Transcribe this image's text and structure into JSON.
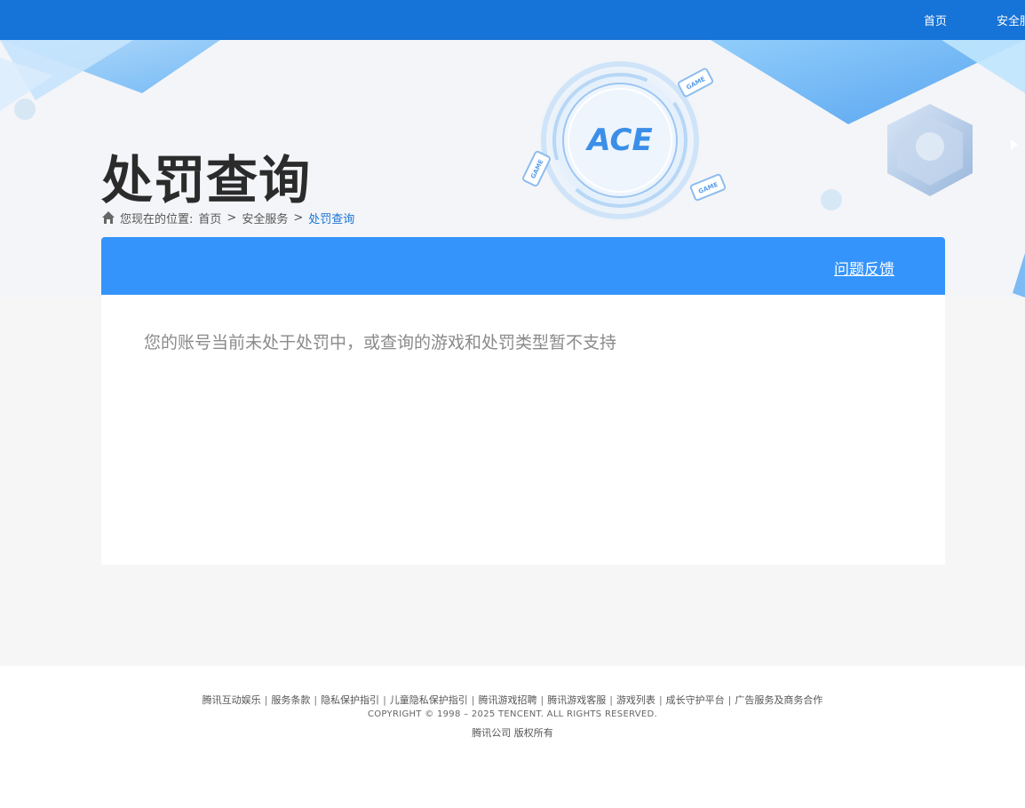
{
  "topnav": {
    "items": [
      {
        "label": "首页"
      },
      {
        "label": "安全服务"
      }
    ]
  },
  "banner": {
    "title": "处罚查询",
    "logo_text": "ACE",
    "game_tag": "GAME"
  },
  "breadcrumb": {
    "prefix": "您现在的位置:",
    "items": [
      {
        "label": "首页"
      },
      {
        "label": "安全服务"
      },
      {
        "label": "处罚查询"
      }
    ],
    "separator": ">"
  },
  "panel": {
    "feedback_label": "问题反馈",
    "message": "您的账号当前未处于处罚中，或查询的游戏和处罚类型暂不支持"
  },
  "footer": {
    "links": [
      {
        "label": "腾讯互动娱乐"
      },
      {
        "label": "服务条款"
      },
      {
        "label": "隐私保护指引"
      },
      {
        "label": "儿童隐私保护指引"
      },
      {
        "label": "腾讯游戏招聘"
      },
      {
        "label": "腾讯游戏客服"
      },
      {
        "label": "游戏列表"
      },
      {
        "label": "成长守护平台"
      },
      {
        "label": "广告服务及商务合作"
      }
    ],
    "copyright": "COPYRIGHT © 1998 – 2025 TENCENT. ALL RIGHTS RESERVED.",
    "company": "腾讯公司 版权所有"
  },
  "colors": {
    "topbar": "#1673d7",
    "panel_header": "#3594fb",
    "breadcrumb_current": "#1673d7"
  }
}
